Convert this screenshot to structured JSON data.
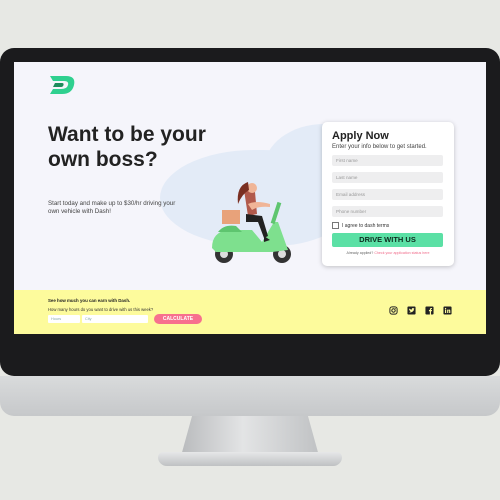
{
  "hero": {
    "title": "Want to be your own boss?",
    "subtitle": "Start today and make up to $30/hr driving your own vehicle with Dash!"
  },
  "form": {
    "title": "Apply Now",
    "subtitle": "Enter your info below to get started.",
    "first_name_placeholder": "First name",
    "last_name_placeholder": "Last name",
    "email_placeholder": "Email address",
    "phone_placeholder": "Phone number",
    "terms_label": "I agree to dash terms",
    "submit_label": "DRIVE WITH US",
    "applied_text": "Already applied?",
    "applied_link": "Check your application status here"
  },
  "calculator": {
    "title": "See how much you can earn with Dash.",
    "question": "How many hours do you want to drive with us this week?",
    "hours_placeholder": "Hours",
    "city_placeholder": "City",
    "button_label": "CALCULATE"
  },
  "social": [
    "instagram-icon",
    "twitter-icon",
    "facebook-icon",
    "linkedin-icon"
  ],
  "colors": {
    "accent_green": "#5be0a5",
    "calc_bar": "#fdfb9c",
    "calc_button": "#f7708e",
    "page_bg": "#f5f5fb"
  }
}
